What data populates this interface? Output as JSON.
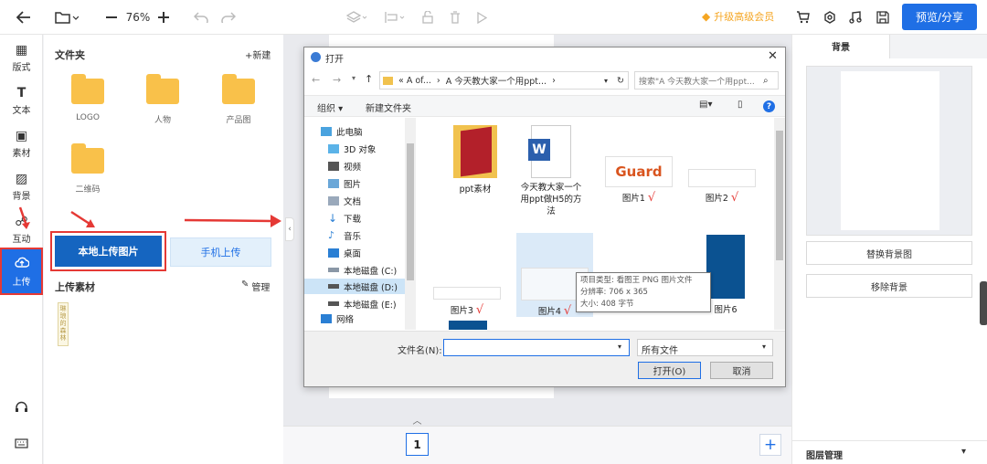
{
  "topbar": {
    "zoom": "76%",
    "vip_label": "升级高级会员",
    "preview_label": "预览/分享"
  },
  "leftnav": {
    "items": [
      {
        "label": "版式"
      },
      {
        "label": "文本"
      },
      {
        "label": "素材"
      },
      {
        "label": "背景"
      },
      {
        "label": "互动"
      },
      {
        "label": "上传"
      }
    ]
  },
  "panel": {
    "folders_title": "文件夹",
    "new_label": "+新建",
    "folders": [
      {
        "label": "LOGO"
      },
      {
        "label": "人物"
      },
      {
        "label": "产品图"
      },
      {
        "label": "二维码"
      }
    ],
    "local_upload_label": "本地上传图片",
    "phone_upload_label": "手机上传",
    "uploads_title": "上传素材",
    "manage_label": "管理",
    "thumb_text": "琳琅的森林"
  },
  "right": {
    "tab_label": "背景",
    "replace_bg_label": "替换背景图",
    "remove_bg_label": "移除背景",
    "layers_label": "图层管理"
  },
  "canvas": {
    "page_number": "1"
  },
  "dialog": {
    "title": "打开",
    "breadcrumb": [
      "« A of...",
      "A 今天教大家一个用ppt..."
    ],
    "search_placeholder": "搜索\"A 今天教大家一个用ppt...",
    "organize_label": "组织 ▾",
    "new_folder_label": "新建文件夹",
    "tree": [
      {
        "label": "此电脑"
      },
      {
        "label": "3D 对象"
      },
      {
        "label": "视频"
      },
      {
        "label": "图片"
      },
      {
        "label": "文档"
      },
      {
        "label": "下载"
      },
      {
        "label": "音乐"
      },
      {
        "label": "桌面"
      },
      {
        "label": "本地磁盘 (C:)"
      },
      {
        "label": "本地磁盘 (D:)"
      },
      {
        "label": "本地磁盘 (E:)"
      },
      {
        "label": "网络"
      }
    ],
    "files": [
      {
        "label": "ppt素材"
      },
      {
        "label": "今天教大家一个用ppt做H5的方法"
      },
      {
        "label": "图片1"
      },
      {
        "label": "图片2"
      },
      {
        "label": "图片3"
      },
      {
        "label": "图片4"
      },
      {
        "label": "图片6"
      }
    ],
    "guard_text": "Guard",
    "word_glyph": "W",
    "tooltip": {
      "line1": "项目类型: 看图王 PNG 图片文件",
      "line2": "分辨率: 706 x 365",
      "line3": "大小: 408 字节"
    },
    "filename_label": "文件名(N):",
    "filetype_value": "所有文件",
    "open_label": "打开(O)",
    "cancel_label": "取消",
    "check_mark": "√"
  },
  "colors": {
    "accent": "#1f6fe5",
    "highlight_red": "#e53935",
    "folder_yellow": "#f9c14a",
    "vip_gold": "#f5a623"
  }
}
